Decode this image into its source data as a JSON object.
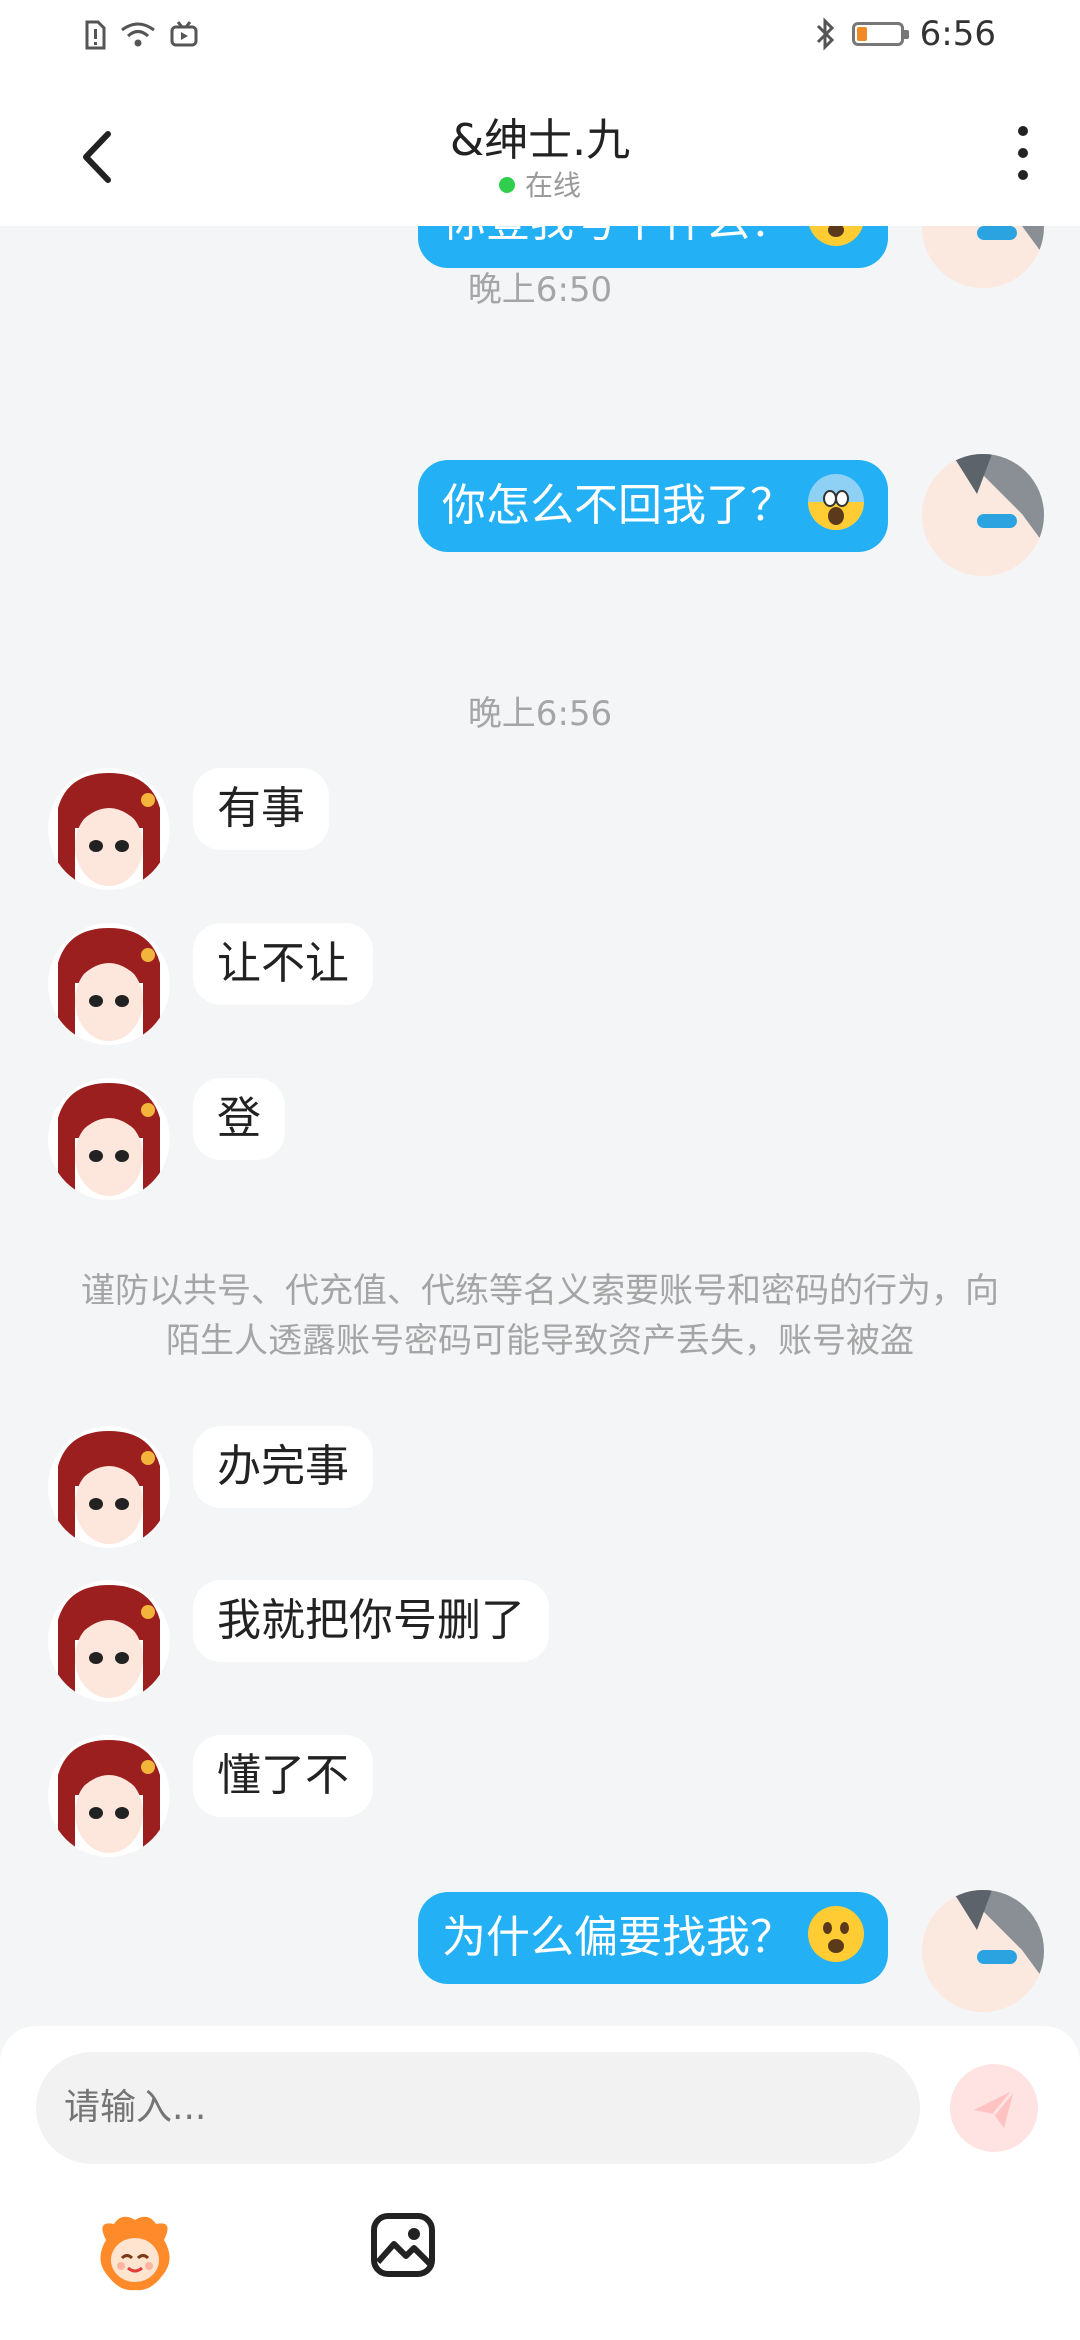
{
  "status_bar": {
    "time": "6:56"
  },
  "header": {
    "title": "&绅士.九",
    "status": "在线"
  },
  "chat": {
    "messages": [
      {
        "side": "out",
        "text": "你登我号干什么？"
      },
      {
        "type": "time",
        "text": "晚上6:50"
      },
      {
        "side": "out",
        "text": "你怎么不回我了？"
      },
      {
        "type": "time",
        "text": "晚上6:56"
      },
      {
        "side": "in",
        "text": "有事"
      },
      {
        "side": "in",
        "text": "让不让"
      },
      {
        "side": "in",
        "text": "登"
      },
      {
        "type": "notice",
        "text": "谨防以共号、代充值、代练等名义索要账号和密码的行为，向陌生人透露账号密码可能导致资产丢失，账号被盗"
      },
      {
        "side": "in",
        "text": "办完事"
      },
      {
        "side": "in",
        "text": "我就把你号删了"
      },
      {
        "side": "in",
        "text": "懂了不"
      },
      {
        "side": "out",
        "text": "为什么偏要找我？"
      }
    ]
  },
  "input": {
    "placeholder": "请输入..."
  },
  "colors": {
    "outgoing_bubble": "#23b0f5",
    "online_dot": "#2fcf4d",
    "send_button": "#ffe3e3"
  },
  "icons": [
    "back-arrow-icon",
    "more-vertical-icon",
    "send-icon",
    "sticker-icon",
    "image-icon"
  ]
}
